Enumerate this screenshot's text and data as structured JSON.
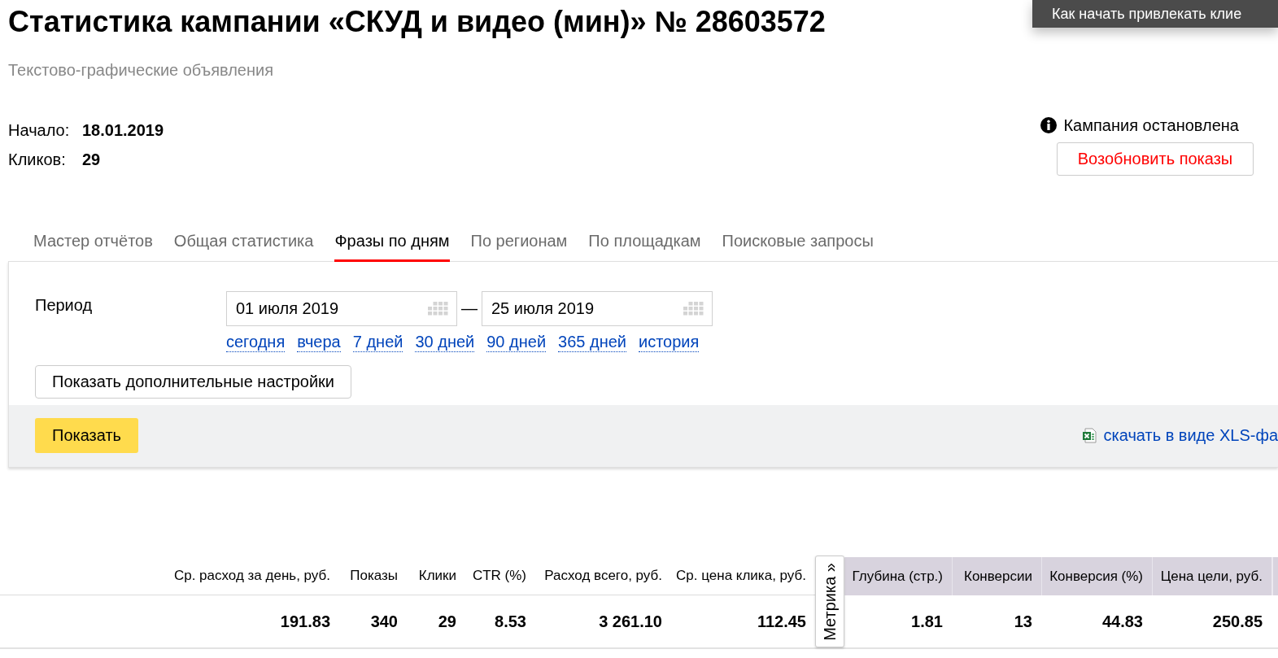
{
  "popup": {
    "text": "Как начать привлекать клие"
  },
  "page": {
    "title": "Статистика кампании «СКУД и видео (мин)» № 28603572",
    "subtitle": "Текстово-графические объявления"
  },
  "summary": [
    {
      "label": "Начало:",
      "value": "18.01.2019"
    },
    {
      "label": "Кликов:",
      "value": "29"
    }
  ],
  "status": {
    "text": "Кампания остановлена",
    "button": "Возобновить показы"
  },
  "tabs": [
    {
      "label": "Мастер отчётов",
      "selected": false
    },
    {
      "label": "Общая статистика",
      "selected": false
    },
    {
      "label": "Фразы по дням",
      "selected": true
    },
    {
      "label": "По регионам",
      "selected": false
    },
    {
      "label": "По площадкам",
      "selected": false
    },
    {
      "label": "Поисковые запросы",
      "selected": false
    }
  ],
  "filters": {
    "period_label": "Период",
    "date_from": "01 июля 2019",
    "separator": "—",
    "date_to": "25 июля 2019",
    "quick_ranges": [
      "сегодня",
      "вчера",
      "7 дней",
      "30 дней",
      "90 дней",
      "365 дней",
      "история"
    ],
    "more_settings_button": "Показать дополнительные настройки",
    "show_button": "Показать",
    "download_link": "скачать в виде XLS-фа"
  },
  "table": {
    "metrika_tab": "Метрика »",
    "columns": [
      {
        "label": "Ср. расход за день, руб.",
        "kind": "direct"
      },
      {
        "label": "Показы",
        "kind": "direct"
      },
      {
        "label": "Клики",
        "kind": "direct"
      },
      {
        "label": "CTR (%)",
        "kind": "direct"
      },
      {
        "label": "Расход всего, руб.",
        "kind": "direct"
      },
      {
        "label": "Ср. цена клика, руб.",
        "kind": "direct"
      },
      {
        "label": "Глубина (стр.)",
        "kind": "metrika"
      },
      {
        "label": "Конверсии",
        "kind": "metrika"
      },
      {
        "label": "Конверсия (%)",
        "kind": "metrika"
      },
      {
        "label": "Цена цели, руб.",
        "kind": "metrika"
      }
    ],
    "rows": [
      [
        "191.83",
        "340",
        "29",
        "8.53",
        "3 261.10",
        "112.45",
        "1.81",
        "13",
        "44.83",
        "250.85"
      ]
    ]
  }
}
